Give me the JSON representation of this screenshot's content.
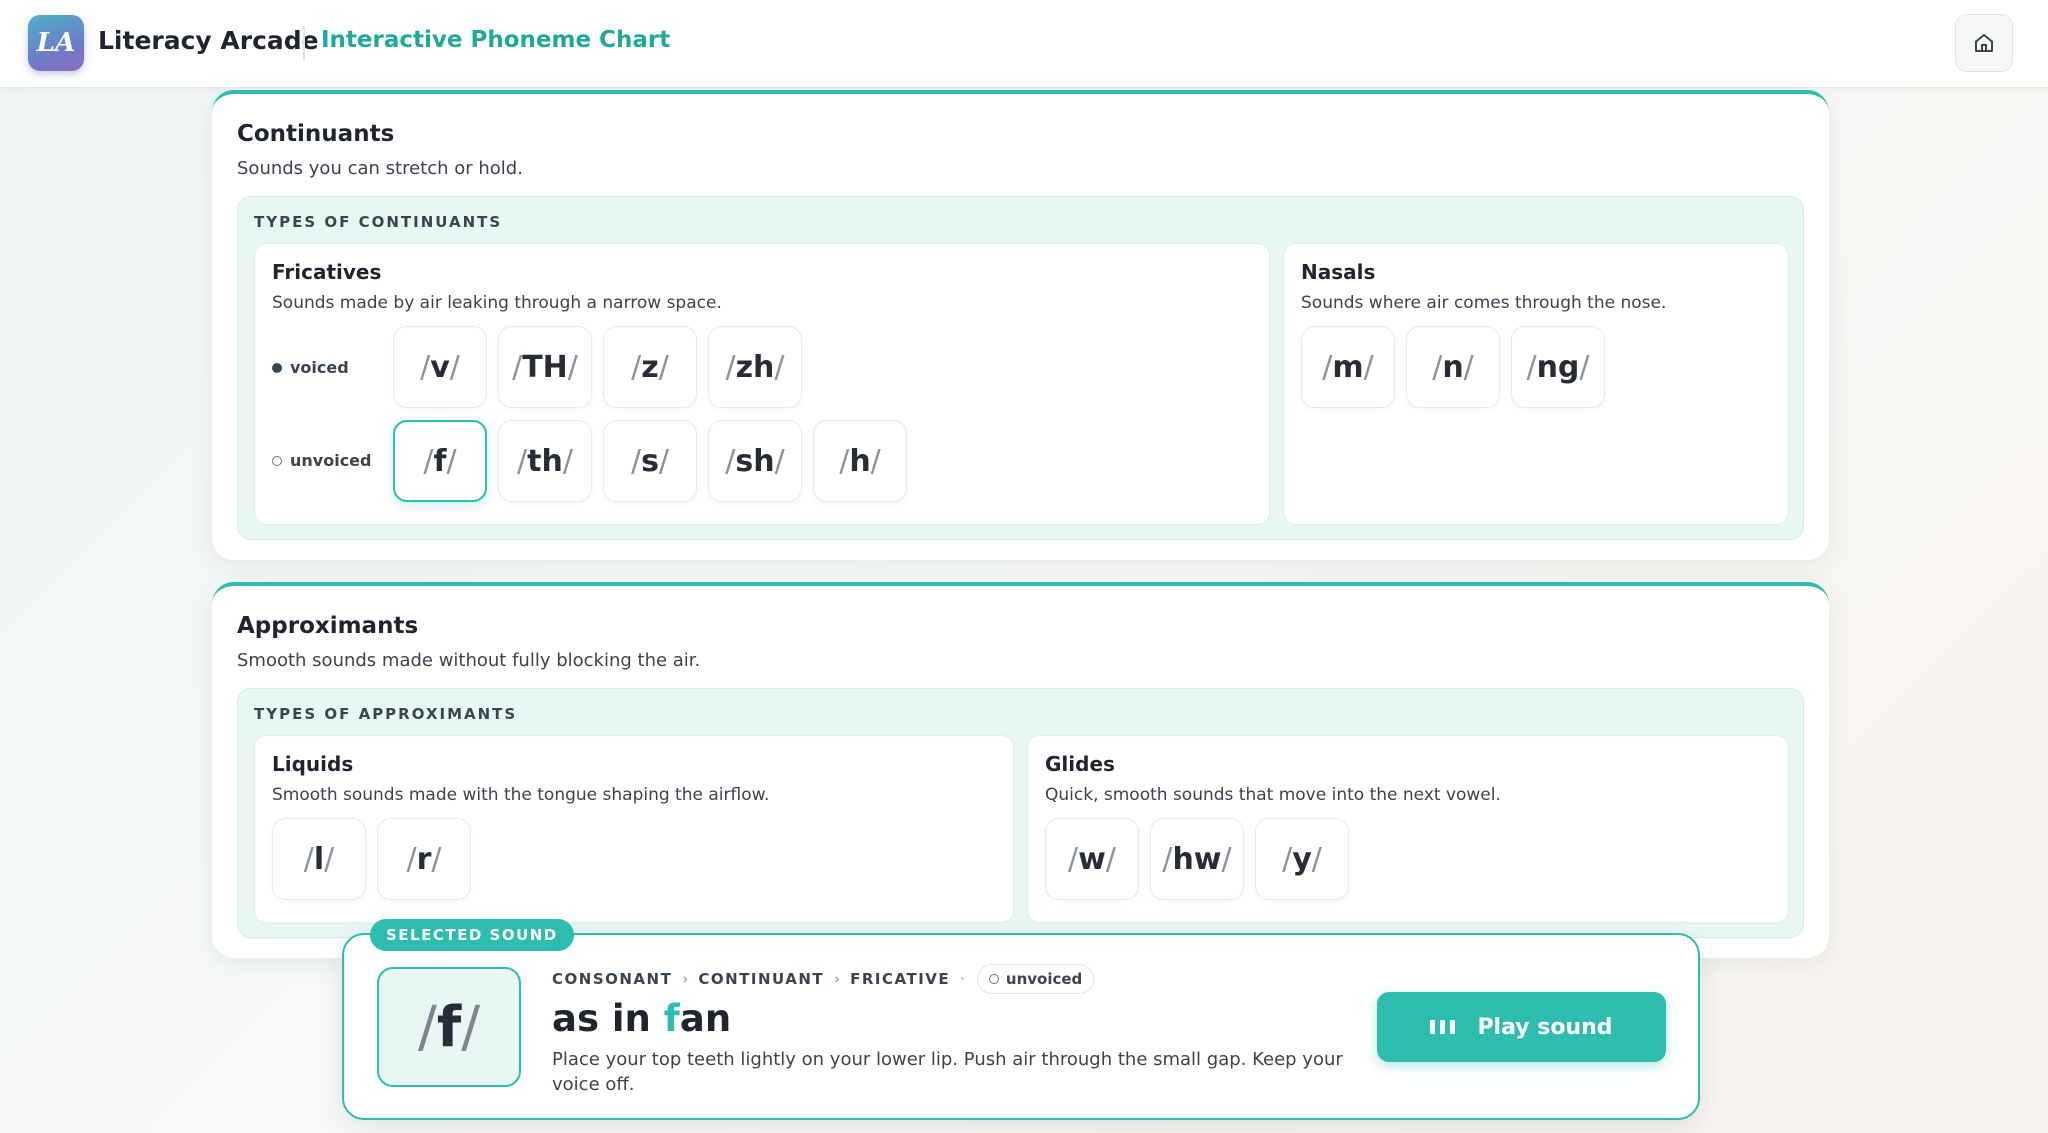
{
  "header": {
    "logo_text": "LA",
    "app_title": "Literacy Arcade",
    "page_subtitle": "Interactive Phoneme Chart",
    "home_icon": "home-icon"
  },
  "continuants": {
    "title": "Continuants",
    "desc": "Sounds you can stretch or hold.",
    "types_label": "TYPES OF CONTINUANTS",
    "fricatives": {
      "title": "Fricatives",
      "desc": "Sounds made by air leaking through a narrow space.",
      "voiced_label": "voiced",
      "unvoiced_label": "unvoiced",
      "voiced": [
        "v",
        "TH",
        "z",
        "zh"
      ],
      "unvoiced": [
        "f",
        "th",
        "s",
        "sh",
        "h"
      ]
    },
    "nasals": {
      "title": "Nasals",
      "desc": "Sounds where air comes through the nose.",
      "sounds": [
        "m",
        "n",
        "ng"
      ]
    }
  },
  "approximants": {
    "title": "Approximants",
    "desc": "Smooth sounds made without fully blocking the air.",
    "types_label": "TYPES OF APPROXIMANTS",
    "liquids": {
      "title": "Liquids",
      "desc": "Smooth sounds made with the tongue shaping the airflow.",
      "sounds": [
        "l",
        "r"
      ]
    },
    "glides": {
      "title": "Glides",
      "desc": "Quick, smooth sounds that move into the next vowel.",
      "sounds": [
        "w",
        "hw",
        "y"
      ]
    }
  },
  "selected": {
    "badge": "SELECTED SOUND",
    "phoneme": "f",
    "breadcrumb": [
      "CONSONANT",
      "CONTINUANT",
      "FRICATIVE"
    ],
    "voicing": "unvoiced",
    "example_prefix": "as in ",
    "example_highlight": "f",
    "example_suffix": "an",
    "instruction": "Place your top teeth lightly on your lower lip. Push air through the small gap. Keep your voice off.",
    "play_label": "Play sound"
  },
  "colors": {
    "accent": "#2dbdae",
    "text": "#1f2530",
    "panel": "#e9f7f4"
  }
}
